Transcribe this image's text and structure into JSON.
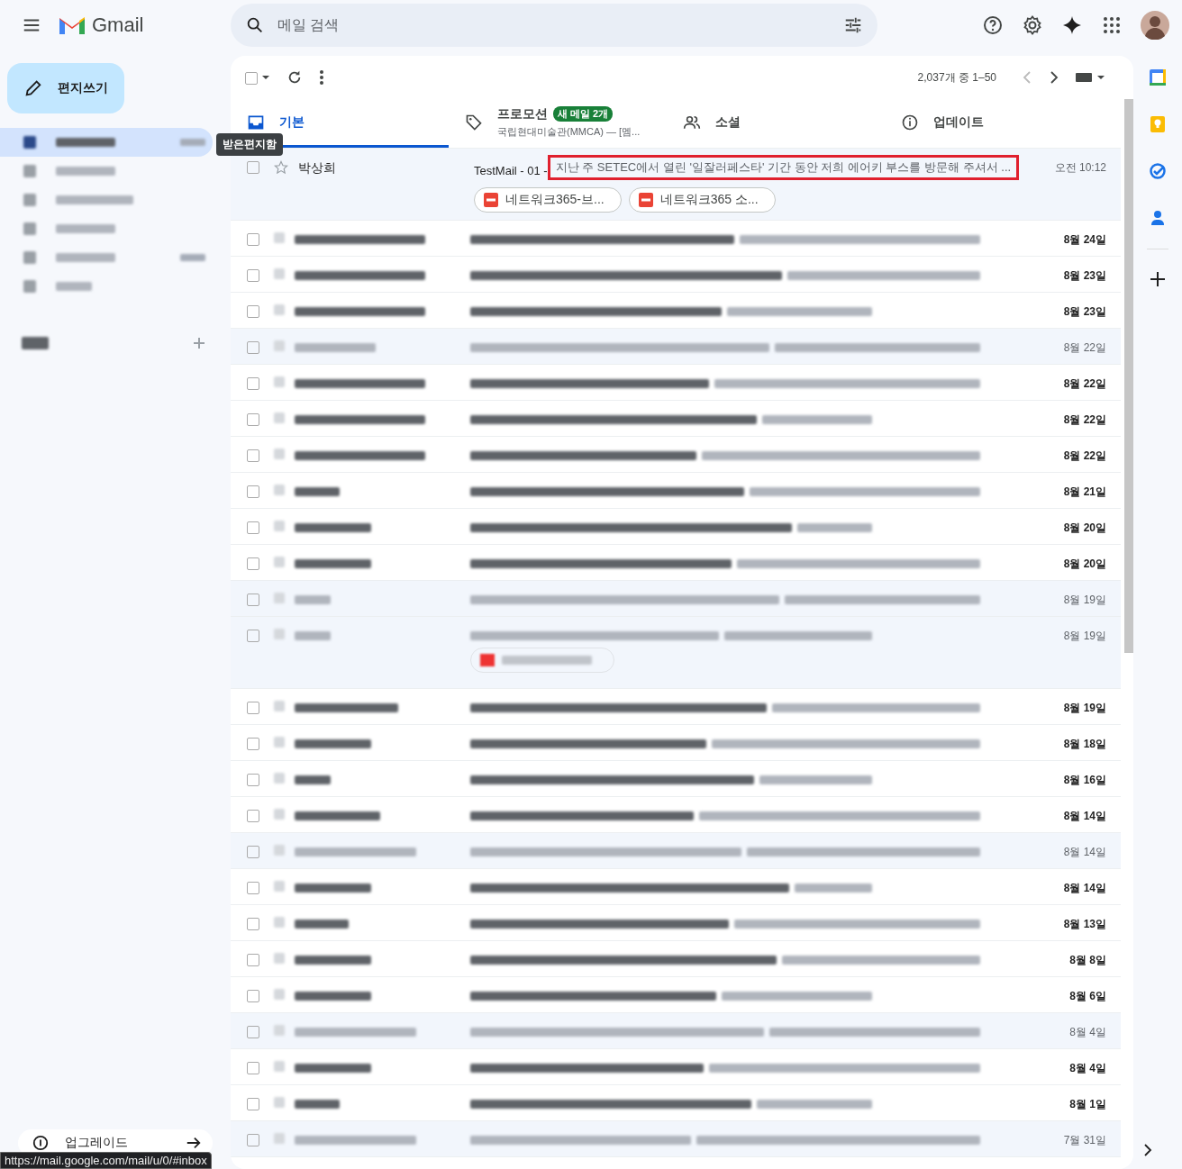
{
  "header": {
    "app_name": "Gmail",
    "search": {
      "placeholder": "메일 검색"
    }
  },
  "compose": {
    "label": "편지쓰기"
  },
  "sidebar": {
    "items": [
      {
        "selected": true,
        "has_count": true
      },
      {
        "selected": false,
        "has_count": false
      },
      {
        "selected": false,
        "has_count": false
      },
      {
        "selected": false,
        "has_count": false
      },
      {
        "selected": false,
        "has_count": true
      },
      {
        "selected": false,
        "has_count": false
      }
    ],
    "tooltip": "받은편지함"
  },
  "upgrade": {
    "label": "업그레이드"
  },
  "status_url": "https://mail.google.com/mail/u/0/#inbox",
  "toolbar": {
    "select_all_checked": false,
    "page_info": "2,037개 중 1–50"
  },
  "tabs": [
    {
      "label": "기본",
      "selected": true
    },
    {
      "label": "프로모션",
      "selected": false,
      "badge": "새 메일 2개",
      "subtitle": "국립현대미술관(MMCA) — [멤..."
    },
    {
      "label": "소셜",
      "selected": false
    },
    {
      "label": "업데이트",
      "selected": false
    }
  ],
  "messages": [
    {
      "kind": "clear",
      "unread": false,
      "sender": "박상희",
      "subject": "TestMail - 01 -",
      "snippet": "지난 주 SETEC에서 열린 '일잘러페스타' 기간 동안 저희 에어키 부스를 방문해 주셔서 ...",
      "highlighted": true,
      "date": "오전 10:12",
      "attachments": [
        "네트워크365-브...",
        "네트워크365 소..."
      ]
    },
    {
      "kind": "blurred",
      "unread": true,
      "date": "8월 24일"
    },
    {
      "kind": "blurred",
      "unread": true,
      "date": "8월 23일"
    },
    {
      "kind": "blurred",
      "unread": true,
      "date": "8월 23일"
    },
    {
      "kind": "blurred",
      "unread": false,
      "date": "8월 22일"
    },
    {
      "kind": "blurred",
      "unread": true,
      "date": "8월 22일"
    },
    {
      "kind": "blurred",
      "unread": true,
      "date": "8월 22일"
    },
    {
      "kind": "blurred",
      "unread": true,
      "date": "8월 22일"
    },
    {
      "kind": "blurred",
      "unread": true,
      "date": "8월 21일"
    },
    {
      "kind": "blurred",
      "unread": true,
      "date": "8월 20일"
    },
    {
      "kind": "blurred",
      "unread": true,
      "date": "8월 20일"
    },
    {
      "kind": "blurred",
      "unread": false,
      "date": "8월 19일"
    },
    {
      "kind": "blurred",
      "unread": false,
      "date": "8월 19일",
      "has_attachment": true
    },
    {
      "kind": "blurred",
      "unread": true,
      "date": "8월 19일"
    },
    {
      "kind": "blurred",
      "unread": true,
      "date": "8월 18일"
    },
    {
      "kind": "blurred",
      "unread": true,
      "date": "8월 16일"
    },
    {
      "kind": "blurred",
      "unread": true,
      "date": "8월 14일"
    },
    {
      "kind": "blurred",
      "unread": false,
      "date": "8월 14일"
    },
    {
      "kind": "blurred",
      "unread": true,
      "date": "8월 14일"
    },
    {
      "kind": "blurred",
      "unread": true,
      "date": "8월 13일"
    },
    {
      "kind": "blurred",
      "unread": true,
      "date": "8월 8일"
    },
    {
      "kind": "blurred",
      "unread": true,
      "date": "8월 6일"
    },
    {
      "kind": "blurred",
      "unread": false,
      "date": "8월 4일"
    },
    {
      "kind": "blurred",
      "unread": true,
      "date": "8월 4일"
    },
    {
      "kind": "blurred",
      "unread": true,
      "date": "8월 1일"
    },
    {
      "kind": "blurred",
      "unread": false,
      "date": "7월 31일"
    }
  ]
}
